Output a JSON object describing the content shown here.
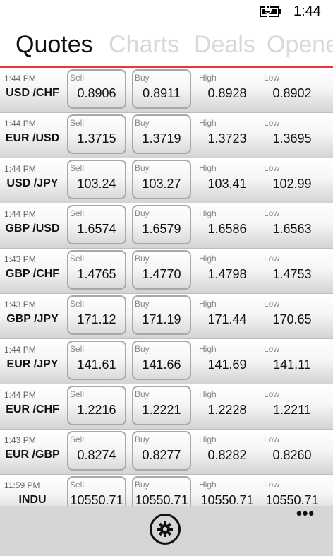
{
  "status": {
    "time": "1:44",
    "battery_icon": "battery-charging-icon"
  },
  "pivot": {
    "tabs": [
      "Quotes",
      "Charts",
      "Deals",
      "Opene"
    ],
    "active": 0,
    "accent": "#e8383a"
  },
  "labels": {
    "sell": "Sell",
    "buy": "Buy",
    "high": "High",
    "low": "Low"
  },
  "quotes": [
    {
      "time": "1:44 PM",
      "pair": "USD /CHF",
      "sell": "0.8906",
      "buy": "0.8911",
      "high": "0.8928",
      "low": "0.8902"
    },
    {
      "time": "1:44 PM",
      "pair": "EUR /USD",
      "sell": "1.3715",
      "buy": "1.3719",
      "high": "1.3723",
      "low": "1.3695"
    },
    {
      "time": "1:44 PM",
      "pair": "USD /JPY",
      "sell": "103.24",
      "buy": "103.27",
      "high": "103.41",
      "low": "102.99"
    },
    {
      "time": "1:44 PM",
      "pair": "GBP /USD",
      "sell": "1.6574",
      "buy": "1.6579",
      "high": "1.6586",
      "low": "1.6563"
    },
    {
      "time": "1:43 PM",
      "pair": "GBP /CHF",
      "sell": "1.4765",
      "buy": "1.4770",
      "high": "1.4798",
      "low": "1.4753"
    },
    {
      "time": "1:43 PM",
      "pair": "GBP /JPY",
      "sell": "171.12",
      "buy": "171.19",
      "high": "171.44",
      "low": "170.65"
    },
    {
      "time": "1:44 PM",
      "pair": "EUR /JPY",
      "sell": "141.61",
      "buy": "141.66",
      "high": "141.69",
      "low": "141.11"
    },
    {
      "time": "1:44 PM",
      "pair": "EUR /CHF",
      "sell": "1.2216",
      "buy": "1.2221",
      "high": "1.2228",
      "low": "1.2211"
    },
    {
      "time": "1:43 PM",
      "pair": "EUR /GBP",
      "sell": "0.8274",
      "buy": "0.8277",
      "high": "0.8282",
      "low": "0.8260"
    },
    {
      "time": "11:59 PM",
      "pair": "INDU",
      "sell": "10550.71",
      "buy": "10550.71",
      "high": "10550.71",
      "low": "10550.71"
    }
  ],
  "appbar": {
    "settings_icon": "gear-icon",
    "more_icon": "ellipsis-icon",
    "more_label": "•••"
  }
}
